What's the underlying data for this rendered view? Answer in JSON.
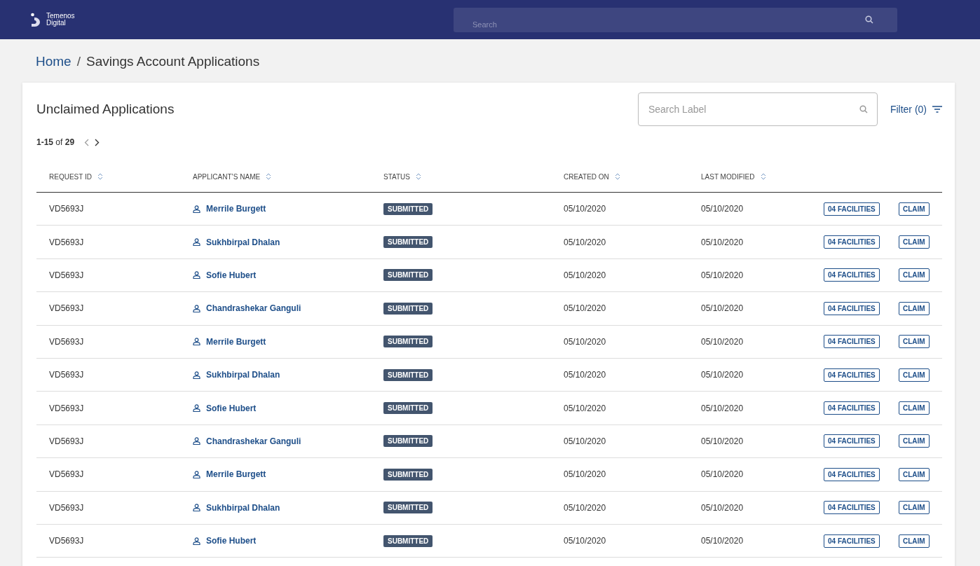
{
  "header": {
    "logo_text": [
      "Temenos",
      "Digital"
    ],
    "search": {
      "placeholder": "Search"
    }
  },
  "breadcrumb": {
    "items": [
      {
        "label": "Home",
        "link": true
      },
      {
        "label": "Savings Account Applications",
        "link": false
      }
    ],
    "separator": "/"
  },
  "card": {
    "title": "Unclaimed Applications",
    "search": {
      "placeholder": "Search Label"
    },
    "filter": "Filter (0)",
    "pagination": "**1-15** of **29**"
  },
  "table": {
    "columns": [
      "REQUEST ID",
      "APPLICANT’S NAME",
      "STATUS",
      "CREATED ON",
      "LAST MODIFIED"
    ],
    "rows": [
      {
        "request_id": "VD5693J",
        "name": "Merrile Burgett",
        "status": "SUBMITTED",
        "created": "05/10/2020",
        "modified": "05/10/2020",
        "facilities": "04 FACILITIES",
        "action": "CLAIM"
      },
      {
        "request_id": "VD5693J",
        "name": "Sukhbirpal Dhalan",
        "status": "SUBMITTED",
        "created": "05/10/2020",
        "modified": "05/10/2020",
        "facilities": "04 FACILITIES",
        "action": "CLAIM"
      },
      {
        "request_id": "VD5693J",
        "name": "Sofie Hubert",
        "status": "SUBMITTED",
        "created": "05/10/2020",
        "modified": "05/10/2020",
        "facilities": "04 FACILITIES",
        "action": "CLAIM"
      },
      {
        "request_id": "VD5693J",
        "name": "Chandrashekar Ganguli",
        "status": "SUBMITTED",
        "created": "05/10/2020",
        "modified": "05/10/2020",
        "facilities": "04 FACILITIES",
        "action": "CLAIM"
      },
      {
        "request_id": "VD5693J",
        "name": "Merrile Burgett",
        "status": "SUBMITTED",
        "created": "05/10/2020",
        "modified": "05/10/2020",
        "facilities": "04 FACILITIES",
        "action": "CLAIM"
      },
      {
        "request_id": "VD5693J",
        "name": "Sukhbirpal Dhalan",
        "status": "SUBMITTED",
        "created": "05/10/2020",
        "modified": "05/10/2020",
        "facilities": "04 FACILITIES",
        "action": "CLAIM"
      },
      {
        "request_id": "VD5693J",
        "name": "Sofie Hubert",
        "status": "SUBMITTED",
        "created": "05/10/2020",
        "modified": "05/10/2020",
        "facilities": "04 FACILITIES",
        "action": "CLAIM"
      },
      {
        "request_id": "VD5693J",
        "name": "Chandrashekar Ganguli",
        "status": "SUBMITTED",
        "created": "05/10/2020",
        "modified": "05/10/2020",
        "facilities": "04 FACILITIES",
        "action": "CLAIM"
      },
      {
        "request_id": "VD5693J",
        "name": "Merrile Burgett",
        "status": "SUBMITTED",
        "created": "05/10/2020",
        "modified": "05/10/2020",
        "facilities": "04 FACILITIES",
        "action": "CLAIM"
      },
      {
        "request_id": "VD5693J",
        "name": "Sukhbirpal Dhalan",
        "status": "SUBMITTED",
        "created": "05/10/2020",
        "modified": "05/10/2020",
        "facilities": "04 FACILITIES",
        "action": "CLAIM"
      },
      {
        "request_id": "VD5693J",
        "name": "Sofie Hubert",
        "status": "SUBMITTED",
        "created": "05/10/2020",
        "modified": "05/10/2020",
        "facilities": "04 FACILITIES",
        "action": "CLAIM"
      }
    ]
  }
}
